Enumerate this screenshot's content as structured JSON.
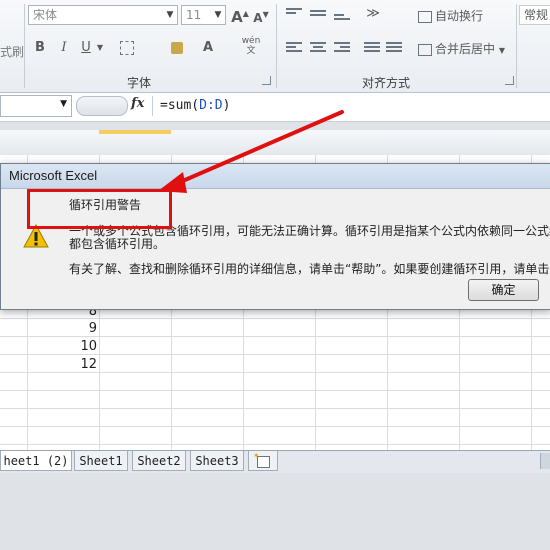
{
  "ribbon": {
    "font_name": "宋体",
    "font_size": "11",
    "grow_font": "A",
    "shrink_font": "A",
    "bold": "B",
    "italic": "I",
    "underline": "U",
    "font_color": "A",
    "phonetic": "wén",
    "wrap_text": "自动换行",
    "merge_center": "合并后居中",
    "number_format": "常规",
    "clipboard_fragment": "式刷",
    "font_group_label": "字体",
    "align_group_label": "对齐方式"
  },
  "formula_bar": {
    "fx": "fx",
    "formula_prefix": "=sum(",
    "formula_ref": "D:D",
    "formula_suffix": ")"
  },
  "sheet": {
    "values": [
      "8",
      "9",
      "10",
      "12"
    ]
  },
  "tabs": [
    "heet1 (2)",
    "Sheet1",
    "Sheet2",
    "Sheet3"
  ],
  "dialog": {
    "title": "Microsoft Excel",
    "heading": "循环引用警告",
    "line1": "一个或多个公式包含循环引用，可能无法正确计算。循环引用是指某个公式内依赖同一公式结",
    "line2": "都包含循环引用。",
    "line3": "有关了解、查找和删除循环引用的详细信息，请单击“帮助”。如果要创建循环引用，请单击",
    "ok_label": "确定"
  },
  "colors": {
    "annotation_red": "#e01010",
    "formula_ref_blue": "#1f4fc8",
    "warning_yellow": "#f2c200"
  }
}
